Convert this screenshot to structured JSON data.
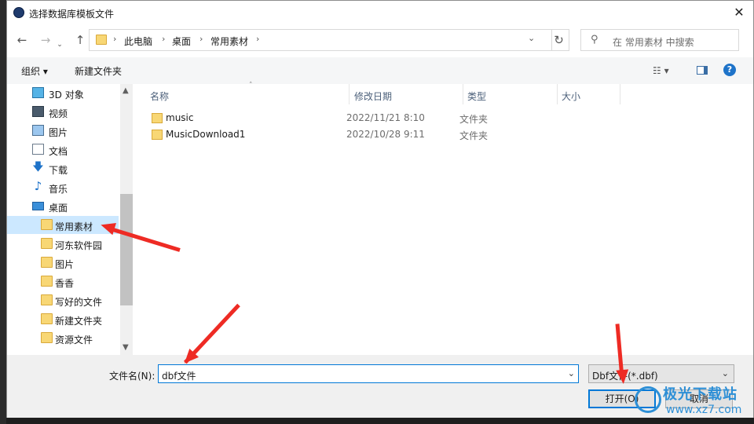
{
  "title": "选择数据库模板文件",
  "nav": {
    "back": "←",
    "forward": "→",
    "up": "↑",
    "refresh": "↻"
  },
  "breadcrumb": [
    "此电脑",
    "桌面",
    "常用素材"
  ],
  "search": {
    "placeholder": "在 常用素材 中搜索"
  },
  "toolbar": {
    "organize": "组织 ▾",
    "new_folder": "新建文件夹",
    "help": "?"
  },
  "sidebar": {
    "items": [
      {
        "label": "3D 对象",
        "icon": "cube-icon"
      },
      {
        "label": "视频",
        "icon": "video-icon"
      },
      {
        "label": "图片",
        "icon": "pictures-icon"
      },
      {
        "label": "文档",
        "icon": "documents-icon"
      },
      {
        "label": "下载",
        "icon": "download-icon"
      },
      {
        "label": "音乐",
        "icon": "music-icon"
      },
      {
        "label": "桌面",
        "icon": "desktop-icon"
      }
    ],
    "subitems": [
      "常用素材",
      "河东软件园",
      "图片",
      "香香",
      "写好的文件",
      "新建文件夹",
      "资源文件"
    ],
    "selected": "常用素材"
  },
  "columns": {
    "name": "名称",
    "date": "修改日期",
    "type": "类型",
    "size": "大小"
  },
  "files": [
    {
      "name": "music",
      "date": "2022/11/21 8:10",
      "type": "文件夹"
    },
    {
      "name": "MusicDownload1",
      "date": "2022/10/28 9:11",
      "type": "文件夹"
    }
  ],
  "filename": {
    "label": "文件名(N):",
    "value": "dbf文件"
  },
  "filter": {
    "value": "Dbf文件(*.dbf)"
  },
  "buttons": {
    "open": "打开(O)",
    "cancel": "取消"
  },
  "watermark": {
    "title": "极光下载站",
    "url": "www.xz7.com"
  },
  "colors": {
    "accent": "#0078d7",
    "arrow": "#ee2b24",
    "selected": "#cce8ff"
  }
}
